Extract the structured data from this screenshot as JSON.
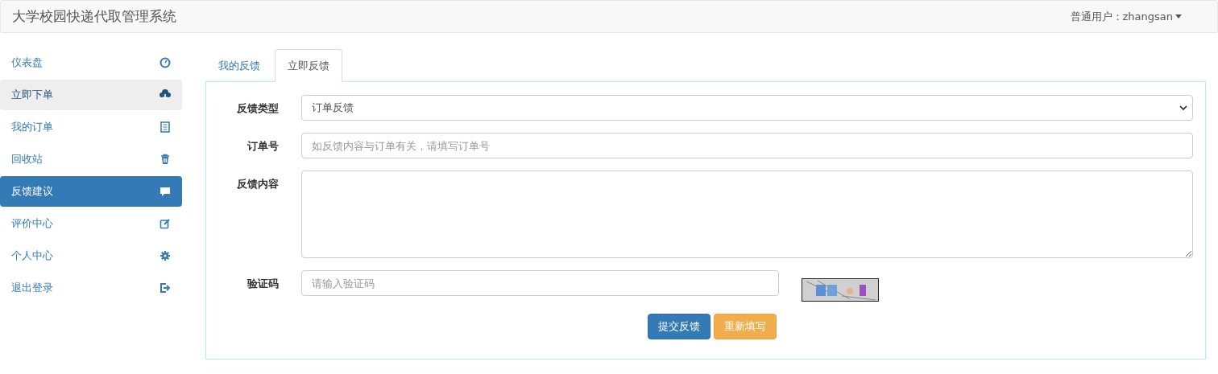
{
  "header": {
    "title": "大学校园快递代取管理系统",
    "user_menu": "普通用户：zhangsan"
  },
  "sidebar": {
    "items": [
      {
        "label": "仪表盘",
        "selected": false,
        "hovered": false
      },
      {
        "label": "立即下单",
        "selected": false,
        "hovered": true
      },
      {
        "label": "我的订单",
        "selected": false,
        "hovered": false
      },
      {
        "label": "回收站",
        "selected": false,
        "hovered": false
      },
      {
        "label": "反馈建议",
        "selected": true,
        "hovered": false
      },
      {
        "label": "评价中心",
        "selected": false,
        "hovered": false
      },
      {
        "label": "个人中心",
        "selected": false,
        "hovered": false
      },
      {
        "label": "退出登录",
        "selected": false,
        "hovered": false
      }
    ]
  },
  "tabs": [
    {
      "label": "我的反馈",
      "selected": false
    },
    {
      "label": "立即反馈",
      "selected": true
    }
  ],
  "form": {
    "fields": [
      {
        "kind": "select",
        "label": "反馈类型",
        "value": "订单反馈"
      },
      {
        "kind": "input",
        "label": "订单号",
        "placeholder": "如反馈内容与订单有关，请填写订单号"
      },
      {
        "kind": "textarea",
        "label": "反馈内容"
      },
      {
        "kind": "captcha",
        "label": "验证码",
        "placeholder": "请输入验证码"
      }
    ],
    "buttons": [
      {
        "label": "提交反馈",
        "kind": "primary"
      },
      {
        "label": "重新填写",
        "kind": "warning"
      }
    ]
  }
}
